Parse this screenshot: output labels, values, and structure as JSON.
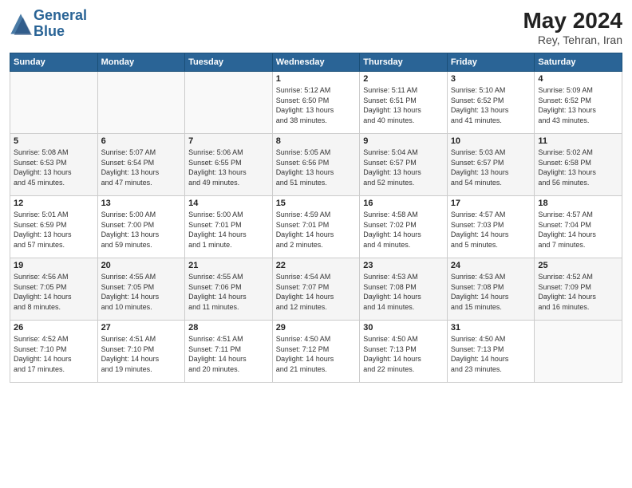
{
  "logo": {
    "line1": "General",
    "line2": "Blue"
  },
  "title": {
    "month_year": "May 2024",
    "location": "Rey, Tehran, Iran"
  },
  "weekdays": [
    "Sunday",
    "Monday",
    "Tuesday",
    "Wednesday",
    "Thursday",
    "Friday",
    "Saturday"
  ],
  "weeks": [
    [
      {
        "day": "",
        "info": ""
      },
      {
        "day": "",
        "info": ""
      },
      {
        "day": "",
        "info": ""
      },
      {
        "day": "1",
        "info": "Sunrise: 5:12 AM\nSunset: 6:50 PM\nDaylight: 13 hours\nand 38 minutes."
      },
      {
        "day": "2",
        "info": "Sunrise: 5:11 AM\nSunset: 6:51 PM\nDaylight: 13 hours\nand 40 minutes."
      },
      {
        "day": "3",
        "info": "Sunrise: 5:10 AM\nSunset: 6:52 PM\nDaylight: 13 hours\nand 41 minutes."
      },
      {
        "day": "4",
        "info": "Sunrise: 5:09 AM\nSunset: 6:52 PM\nDaylight: 13 hours\nand 43 minutes."
      }
    ],
    [
      {
        "day": "5",
        "info": "Sunrise: 5:08 AM\nSunset: 6:53 PM\nDaylight: 13 hours\nand 45 minutes."
      },
      {
        "day": "6",
        "info": "Sunrise: 5:07 AM\nSunset: 6:54 PM\nDaylight: 13 hours\nand 47 minutes."
      },
      {
        "day": "7",
        "info": "Sunrise: 5:06 AM\nSunset: 6:55 PM\nDaylight: 13 hours\nand 49 minutes."
      },
      {
        "day": "8",
        "info": "Sunrise: 5:05 AM\nSunset: 6:56 PM\nDaylight: 13 hours\nand 51 minutes."
      },
      {
        "day": "9",
        "info": "Sunrise: 5:04 AM\nSunset: 6:57 PM\nDaylight: 13 hours\nand 52 minutes."
      },
      {
        "day": "10",
        "info": "Sunrise: 5:03 AM\nSunset: 6:57 PM\nDaylight: 13 hours\nand 54 minutes."
      },
      {
        "day": "11",
        "info": "Sunrise: 5:02 AM\nSunset: 6:58 PM\nDaylight: 13 hours\nand 56 minutes."
      }
    ],
    [
      {
        "day": "12",
        "info": "Sunrise: 5:01 AM\nSunset: 6:59 PM\nDaylight: 13 hours\nand 57 minutes."
      },
      {
        "day": "13",
        "info": "Sunrise: 5:00 AM\nSunset: 7:00 PM\nDaylight: 13 hours\nand 59 minutes."
      },
      {
        "day": "14",
        "info": "Sunrise: 5:00 AM\nSunset: 7:01 PM\nDaylight: 14 hours\nand 1 minute."
      },
      {
        "day": "15",
        "info": "Sunrise: 4:59 AM\nSunset: 7:01 PM\nDaylight: 14 hours\nand 2 minutes."
      },
      {
        "day": "16",
        "info": "Sunrise: 4:58 AM\nSunset: 7:02 PM\nDaylight: 14 hours\nand 4 minutes."
      },
      {
        "day": "17",
        "info": "Sunrise: 4:57 AM\nSunset: 7:03 PM\nDaylight: 14 hours\nand 5 minutes."
      },
      {
        "day": "18",
        "info": "Sunrise: 4:57 AM\nSunset: 7:04 PM\nDaylight: 14 hours\nand 7 minutes."
      }
    ],
    [
      {
        "day": "19",
        "info": "Sunrise: 4:56 AM\nSunset: 7:05 PM\nDaylight: 14 hours\nand 8 minutes."
      },
      {
        "day": "20",
        "info": "Sunrise: 4:55 AM\nSunset: 7:05 PM\nDaylight: 14 hours\nand 10 minutes."
      },
      {
        "day": "21",
        "info": "Sunrise: 4:55 AM\nSunset: 7:06 PM\nDaylight: 14 hours\nand 11 minutes."
      },
      {
        "day": "22",
        "info": "Sunrise: 4:54 AM\nSunset: 7:07 PM\nDaylight: 14 hours\nand 12 minutes."
      },
      {
        "day": "23",
        "info": "Sunrise: 4:53 AM\nSunset: 7:08 PM\nDaylight: 14 hours\nand 14 minutes."
      },
      {
        "day": "24",
        "info": "Sunrise: 4:53 AM\nSunset: 7:08 PM\nDaylight: 14 hours\nand 15 minutes."
      },
      {
        "day": "25",
        "info": "Sunrise: 4:52 AM\nSunset: 7:09 PM\nDaylight: 14 hours\nand 16 minutes."
      }
    ],
    [
      {
        "day": "26",
        "info": "Sunrise: 4:52 AM\nSunset: 7:10 PM\nDaylight: 14 hours\nand 17 minutes."
      },
      {
        "day": "27",
        "info": "Sunrise: 4:51 AM\nSunset: 7:10 PM\nDaylight: 14 hours\nand 19 minutes."
      },
      {
        "day": "28",
        "info": "Sunrise: 4:51 AM\nSunset: 7:11 PM\nDaylight: 14 hours\nand 20 minutes."
      },
      {
        "day": "29",
        "info": "Sunrise: 4:50 AM\nSunset: 7:12 PM\nDaylight: 14 hours\nand 21 minutes."
      },
      {
        "day": "30",
        "info": "Sunrise: 4:50 AM\nSunset: 7:13 PM\nDaylight: 14 hours\nand 22 minutes."
      },
      {
        "day": "31",
        "info": "Sunrise: 4:50 AM\nSunset: 7:13 PM\nDaylight: 14 hours\nand 23 minutes."
      },
      {
        "day": "",
        "info": ""
      }
    ]
  ]
}
